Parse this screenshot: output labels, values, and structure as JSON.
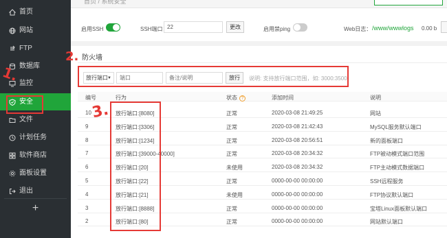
{
  "sidebar": {
    "items": [
      {
        "label": "首页",
        "icon": "home-icon"
      },
      {
        "label": "网站",
        "icon": "globe-icon"
      },
      {
        "label": "FTP",
        "icon": "ftp-icon"
      },
      {
        "label": "数据库",
        "icon": "database-icon"
      },
      {
        "label": "监控",
        "icon": "monitor-icon"
      },
      {
        "label": "安全",
        "icon": "shield-icon",
        "active": true
      },
      {
        "label": "文件",
        "icon": "folder-icon"
      },
      {
        "label": "计划任务",
        "icon": "clock-icon"
      },
      {
        "label": "软件商店",
        "icon": "store-icon"
      },
      {
        "label": "面板设置",
        "icon": "settings-icon"
      },
      {
        "label": "退出",
        "icon": "logout-icon"
      }
    ],
    "add_label": "+"
  },
  "header": {
    "breadcrumb": "首页 / 系统安全"
  },
  "settings": {
    "ssh_toggle_label": "启用SSH",
    "ssh_port_label": "SSH端口：",
    "ssh_port_value": "22",
    "change_button": "更改",
    "ping_label": "启用禁ping",
    "weblog_label": "Web日志：",
    "weblog_path": "/www/wwwlogs",
    "weblog_size": "0.00 b"
  },
  "firewall": {
    "title": "防火墙",
    "select_value": "放行端口",
    "port_placeholder": "端口",
    "note_placeholder": "备注/说明",
    "allow_button": "放行",
    "hint": "说明: 支持放行端口范围，如: 3000:3500",
    "headers": {
      "id": "编号",
      "action": "行为",
      "status": "状态",
      "time": "添加时间",
      "desc": "说明"
    },
    "help_icon": "?",
    "rows": [
      {
        "id": "10",
        "action": "放行端口:[8080]",
        "status": "正常",
        "time": "2020-03-08 21:49:25",
        "desc": "网站"
      },
      {
        "id": "9",
        "action": "放行端口:[3306]",
        "status": "正常",
        "time": "2020-03-08 21:42:43",
        "desc": "MySQL服务默认端口"
      },
      {
        "id": "8",
        "action": "放行端口:[1234]",
        "status": "正常",
        "time": "2020-03-08 20:56:51",
        "desc": "新的面板端口"
      },
      {
        "id": "7",
        "action": "放行端口:[39000-40000]",
        "status": "正常",
        "time": "2020-03-08 20:34:32",
        "desc": "FTP被动模式端口范围"
      },
      {
        "id": "6",
        "action": "放行端口:[20]",
        "status": "未使用",
        "time": "2020-03-08 20:34:32",
        "desc": "FTP主动模式数据端口"
      },
      {
        "id": "5",
        "action": "放行端口:[22]",
        "status": "正常",
        "time": "0000-00-00 00:00:00",
        "desc": "SSH远程服务"
      },
      {
        "id": "4",
        "action": "放行端口:[21]",
        "status": "未使用",
        "time": "0000-00-00 00:00:00",
        "desc": "FTP协议默认端口"
      },
      {
        "id": "3",
        "action": "放行端口:[8888]",
        "status": "正常",
        "time": "0000-00-00 00:00:00",
        "desc": "宝塔Linux面板默认端口"
      },
      {
        "id": "2",
        "action": "放行端口:[80]",
        "status": "正常",
        "time": "0000-00-00 00:00:00",
        "desc": "网站默认端口"
      }
    ]
  },
  "annotations": {
    "mark1": "1.",
    "mark2": "2.",
    "mark3": "3."
  },
  "colors": {
    "accent": "#20a53a",
    "sidebar_bg": "#2a2f33",
    "annotation": "#e53935"
  }
}
